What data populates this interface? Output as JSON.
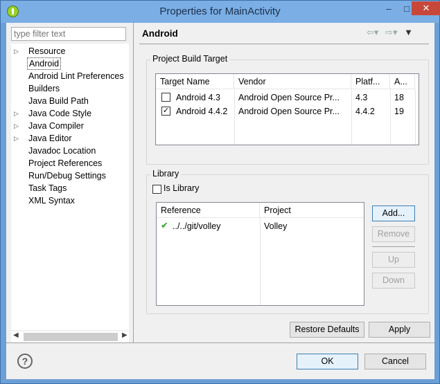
{
  "window": {
    "title": "Properties for MainActivity",
    "controls": {
      "minimize": "–",
      "maximize": "□",
      "close": "✕"
    }
  },
  "filter": {
    "placeholder": "type filter text"
  },
  "tree": {
    "items": [
      {
        "label": "Resource",
        "expandable": true
      },
      {
        "label": "Android",
        "expandable": false,
        "selected": true
      },
      {
        "label": "Android Lint Preferences",
        "expandable": false
      },
      {
        "label": "Builders",
        "expandable": false
      },
      {
        "label": "Java Build Path",
        "expandable": false
      },
      {
        "label": "Java Code Style",
        "expandable": true
      },
      {
        "label": "Java Compiler",
        "expandable": true
      },
      {
        "label": "Java Editor",
        "expandable": true
      },
      {
        "label": "Javadoc Location",
        "expandable": false
      },
      {
        "label": "Project References",
        "expandable": false
      },
      {
        "label": "Run/Debug Settings",
        "expandable": false
      },
      {
        "label": "Task Tags",
        "expandable": false
      },
      {
        "label": "XML Syntax",
        "expandable": false
      }
    ]
  },
  "page": {
    "title": "Android",
    "build_target": {
      "group_title": "Project Build Target",
      "columns": [
        "Target Name",
        "Vendor",
        "Platf...",
        "A..."
      ],
      "rows": [
        {
          "checked": false,
          "name": "Android 4.3",
          "vendor": "Android Open Source Pr...",
          "platform": "4.3",
          "api": "18"
        },
        {
          "checked": true,
          "name": "Android 4.4.2",
          "vendor": "Android Open Source Pr...",
          "platform": "4.4.2",
          "api": "19"
        }
      ]
    },
    "library": {
      "group_title": "Library",
      "is_library_label": "Is Library",
      "is_library_checked": false,
      "columns": [
        "Reference",
        "Project"
      ],
      "rows": [
        {
          "reference": "../../git/volley",
          "project": "Volley"
        }
      ],
      "buttons": {
        "add": "Add...",
        "remove": "Remove",
        "up": "Up",
        "down": "Down"
      }
    },
    "restore_defaults": "Restore Defaults",
    "apply": "Apply"
  },
  "footer": {
    "help": "?",
    "ok": "OK",
    "cancel": "Cancel"
  },
  "colors": {
    "titlebar": "#7aaee5",
    "close": "#c7483b",
    "check": "#2aa52a"
  }
}
